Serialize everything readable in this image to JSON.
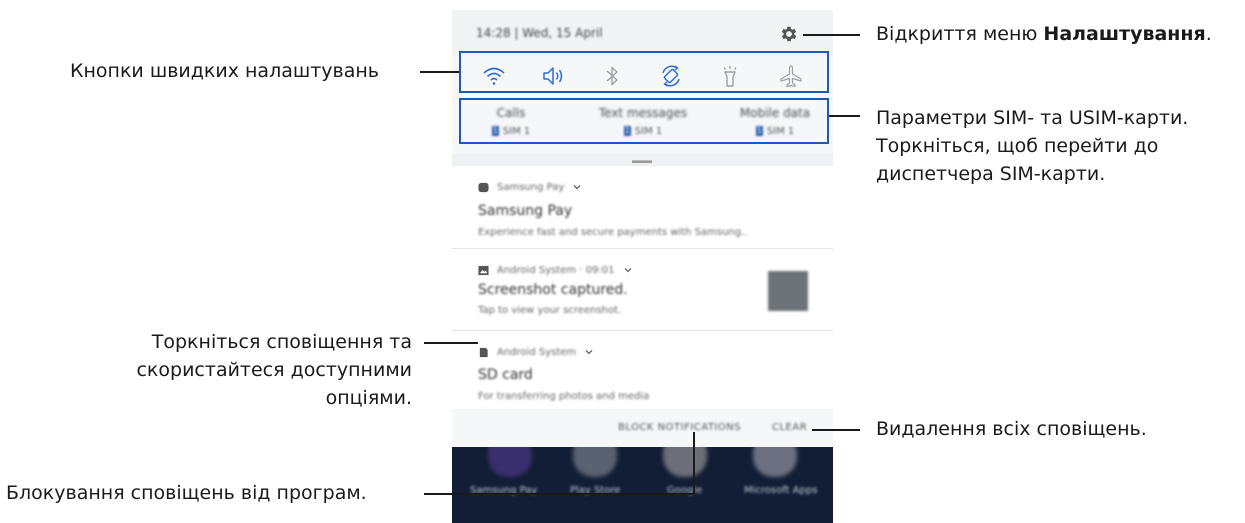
{
  "phone": {
    "status_time": "14:28 | Wed, 15 April",
    "quick_settings": [
      "wifi-icon",
      "sound-icon",
      "bluetooth-icon",
      "auto-rotate-icon",
      "flashlight-icon",
      "airplane-mode-icon"
    ],
    "sim_items": [
      {
        "title": "Calls",
        "badge": "1",
        "sub": "SIM 1"
      },
      {
        "title": "Text messages",
        "badge": "1",
        "sub": "SIM 1"
      },
      {
        "title": "Mobile data",
        "badge": "1",
        "sub": "SIM 1"
      }
    ],
    "notifications": [
      {
        "app": "Samsung Pay",
        "time": "",
        "title": "Samsung Pay",
        "body": "Experience fast and secure payments with Samsung.."
      },
      {
        "app": "Android System · 09:01",
        "title": "Screenshot captured.",
        "body": "Tap to view your screenshot."
      },
      {
        "app": "Android System",
        "title": "SD card",
        "body": "For transferring photos and media"
      }
    ],
    "actions": {
      "block": "BLOCK NOTIFICATIONS",
      "clear": "CLEAR"
    },
    "home_apps": [
      "Samsung Pay",
      "Play Store",
      "Google",
      "Microsoft Apps"
    ]
  },
  "callouts": {
    "quick_settings": "Кнопки швидких налаштувань",
    "settings_menu_prefix": "Відкриття меню ",
    "settings_menu_bold": "Налаштування",
    "settings_menu_suffix": ".",
    "sim_line1": "Параметри SIM- та USIM-карти.",
    "sim_line2": "Торкніться, щоб перейти до",
    "sim_line3": "диспетчера SIM-карти.",
    "notif_line1": "Торкніться сповіщення та",
    "notif_line2": "скористайтеся доступними",
    "notif_line3": "опціями.",
    "clear_all": "Видалення всіх сповіщень.",
    "block_notifs": "Блокування сповіщень від програм."
  },
  "colors": {
    "accent": "#1d5ab4",
    "icon_blue": "#2d6fd6",
    "home_bg": "#121e36"
  }
}
